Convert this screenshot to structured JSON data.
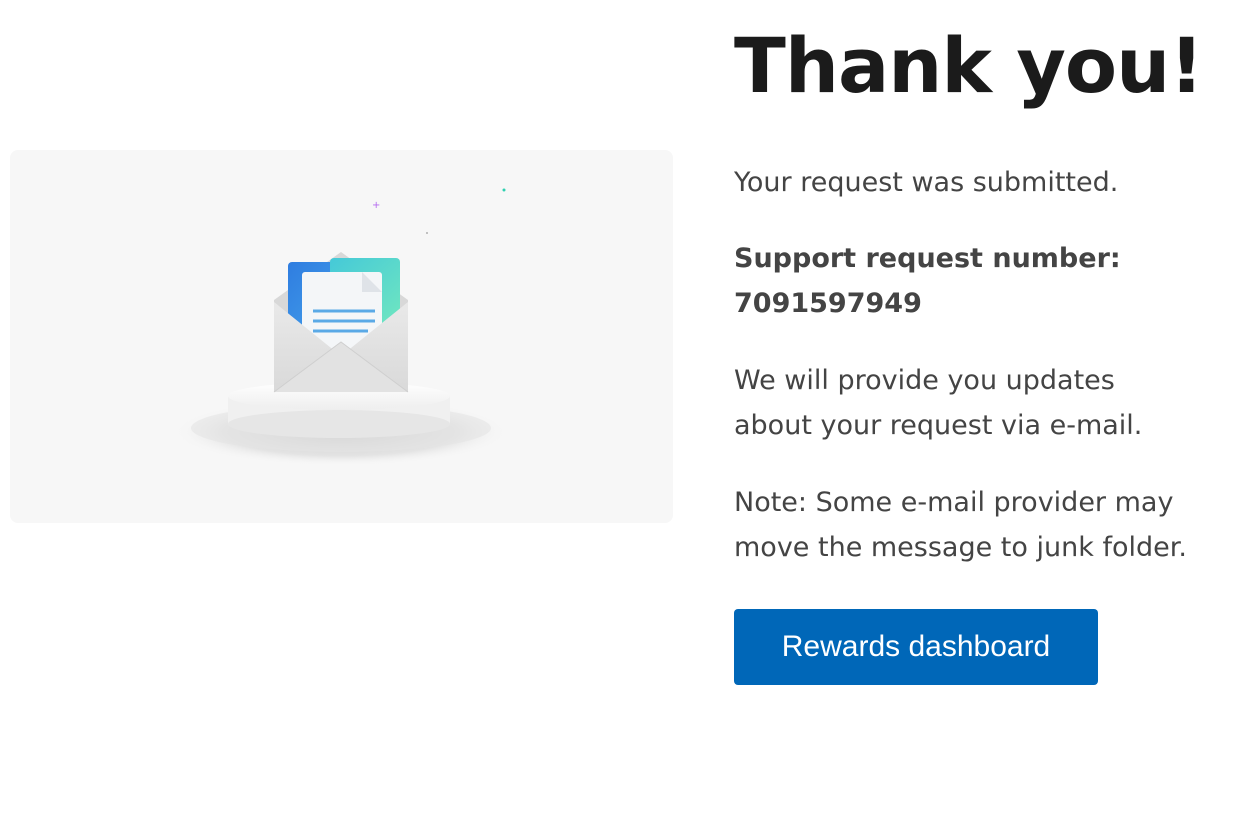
{
  "title": "Thank you!",
  "submitted_text": "Your request was submitted.",
  "support_label": "Support request number:",
  "support_number": "7091597949",
  "updates_text": "We will provide you updates about your request via e-mail.",
  "note_text": "Note: Some e-mail provider may move the message to junk folder.",
  "button_label": "Rewards dashboard",
  "illustration": {
    "icon": "open-envelope-with-document-on-pedestal",
    "colors": {
      "card_background": "#f7f7f7",
      "button_background": "#0067b8",
      "title_color": "#1b1b1b",
      "text_color": "#444444"
    }
  }
}
